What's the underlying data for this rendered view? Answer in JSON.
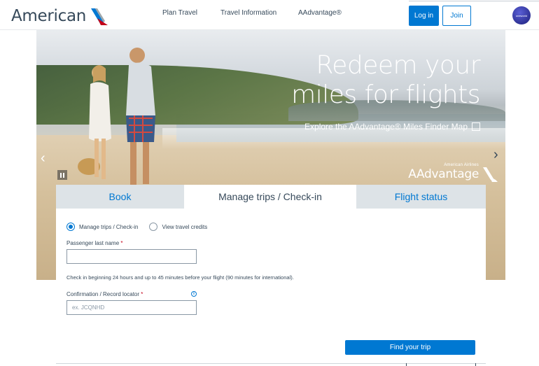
{
  "brand": {
    "name": "American",
    "logo_icon": "american-airlines-flight-symbol"
  },
  "nav": {
    "items": [
      "Plan Travel",
      "Travel Information",
      "AAdvantage®"
    ]
  },
  "header": {
    "login_label": "Log in",
    "join_label": "Join",
    "alliance_label": "oneworld"
  },
  "hero": {
    "title_line1": "Redeem your",
    "title_line2": "miles for flights",
    "subtitle": "Explore the AAdvantage® Miles Finder Map",
    "badge_small": "American Airlines",
    "badge_big": "AAdvantage",
    "prev_arrow": "‹",
    "next_arrow": "›"
  },
  "booking": {
    "tabs": [
      "Book",
      "Manage trips / Check-in",
      "Flight status"
    ],
    "active_tab": 1,
    "radio_options": [
      "Manage trips / Check-in",
      "View travel credits"
    ],
    "selected_option": 0,
    "last_name_label": "Passenger last name",
    "last_name_value": "",
    "checkin_note": "Check in beginning 24 hours and up to 45 minutes before your flight (90 minutes for international).",
    "confirmation_label": "Confirmation / Record locator",
    "confirmation_placeholder": "ex. JCQNHD",
    "required_marker": "*",
    "info_glyph": "i",
    "submit_label": "Find your trip"
  },
  "colors": {
    "brand_blue": "#0078d2",
    "text": "#36495a",
    "required": "#c30019",
    "tab_inactive": "#dde3e7"
  }
}
